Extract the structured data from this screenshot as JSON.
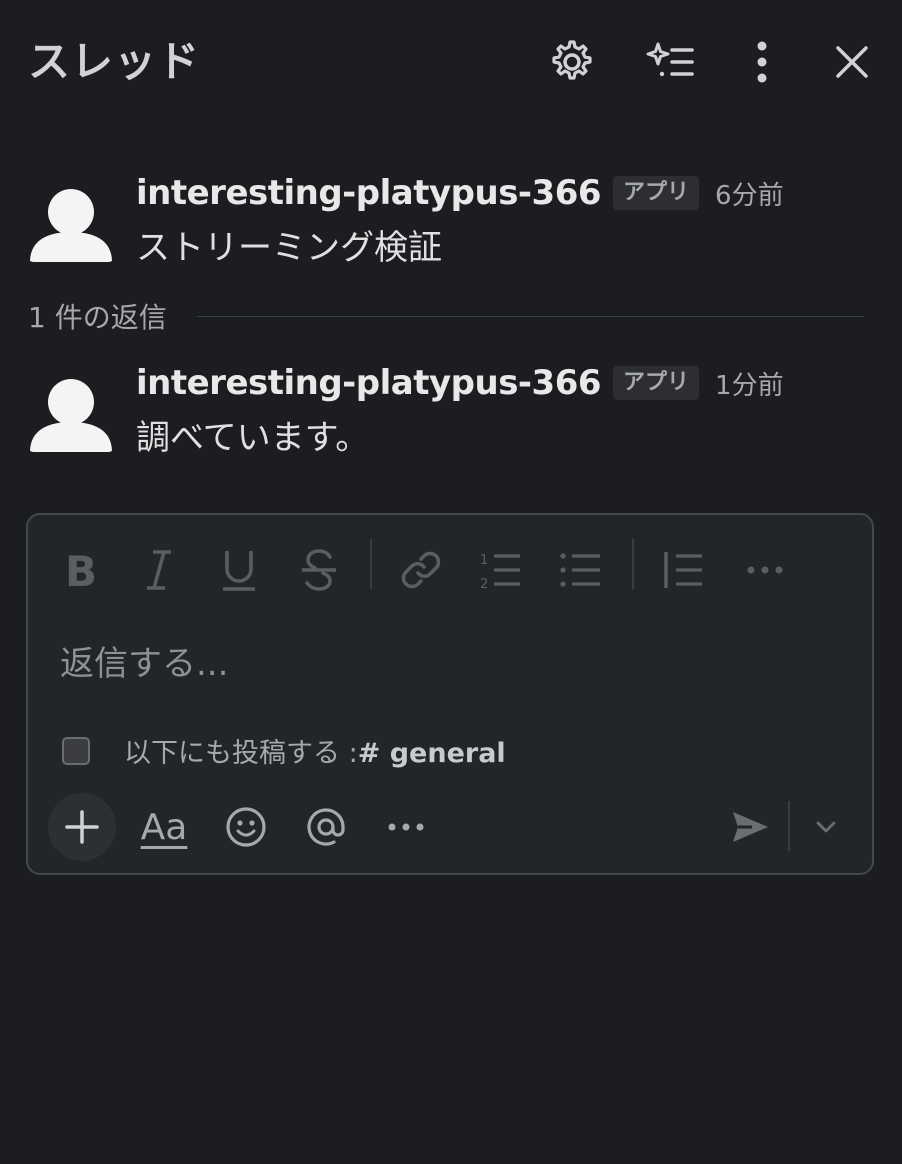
{
  "header": {
    "title": "スレッド"
  },
  "messages": [
    {
      "author": "interesting-platypus-366",
      "badge": "アプリ",
      "time": "6分前",
      "text": "ストリーミング検証"
    },
    {
      "author": "interesting-platypus-366",
      "badge": "アプリ",
      "time": "1分前",
      "text": "調べています。"
    }
  ],
  "replies": {
    "count_label": "1 件の返信"
  },
  "composer": {
    "placeholder": "返信する...",
    "also_post_label": "以下にも投稿する :",
    "also_post_channel": "# general",
    "text_format_label": "Aa"
  },
  "icons": {
    "header": [
      "gear-icon",
      "sparkle-list-icon",
      "more-vertical-icon",
      "close-icon"
    ],
    "toolbar": [
      "bold-icon",
      "italic-icon",
      "underline-icon",
      "strikethrough-icon",
      "link-icon",
      "ordered-list-icon",
      "bulleted-list-icon",
      "blockquote-icon",
      "more-horizontal-icon"
    ],
    "bottom": [
      "plus-icon",
      "emoji-icon",
      "mention-icon",
      "more-horizontal-icon",
      "send-icon",
      "chevron-down-icon"
    ]
  },
  "colors": {
    "background": "#1b1d21",
    "composer_bg": "#222529",
    "text": "#d1d2d3",
    "muted": "#a7a8aa"
  }
}
